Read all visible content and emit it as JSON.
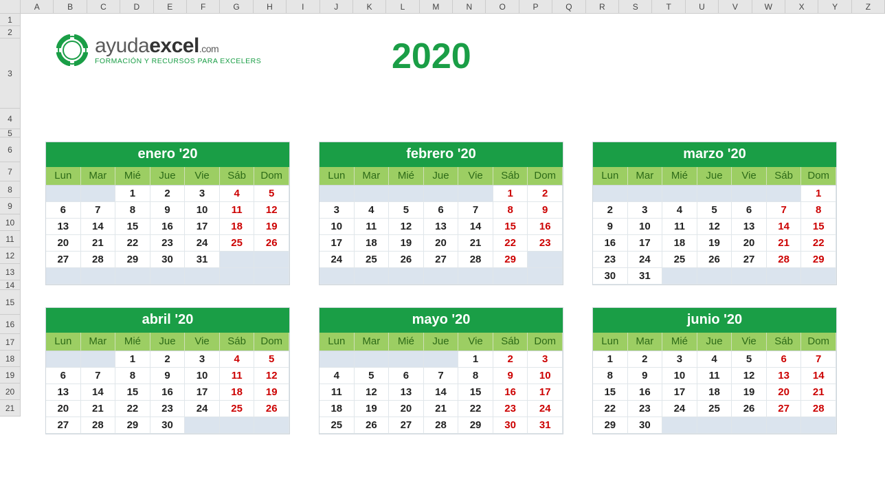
{
  "columns": [
    "A",
    "B",
    "C",
    "D",
    "E",
    "F",
    "G",
    "H",
    "I",
    "J",
    "K",
    "L",
    "M",
    "N",
    "O",
    "P",
    "Q",
    "R",
    "S",
    "T",
    "U",
    "V",
    "W",
    "X",
    "Y",
    "Z"
  ],
  "rows": [
    {
      "n": "1",
      "h": 18
    },
    {
      "n": "2",
      "h": 18
    },
    {
      "n": "3",
      "h": 102
    },
    {
      "n": "4",
      "h": 30
    },
    {
      "n": "5",
      "h": 12
    },
    {
      "n": "6",
      "h": 36
    },
    {
      "n": "7",
      "h": 28
    },
    {
      "n": "8",
      "h": 24
    },
    {
      "n": "9",
      "h": 24
    },
    {
      "n": "10",
      "h": 24
    },
    {
      "n": "11",
      "h": 24
    },
    {
      "n": "12",
      "h": 24
    },
    {
      "n": "13",
      "h": 24
    },
    {
      "n": "14",
      "h": 14
    },
    {
      "n": "15",
      "h": 36
    },
    {
      "n": "16",
      "h": 28
    },
    {
      "n": "17",
      "h": 24
    },
    {
      "n": "18",
      "h": 24
    },
    {
      "n": "19",
      "h": 24
    },
    {
      "n": "20",
      "h": 24
    },
    {
      "n": "21",
      "h": 24
    }
  ],
  "logo": {
    "main_a": "ayuda",
    "main_b": "excel",
    "main_c": ".com",
    "sub": "FORMACIÓN Y RECURSOS PARA EXCELERS"
  },
  "year": "2020",
  "dow": [
    "Lun",
    "Mar",
    "Mié",
    "Jue",
    "Vie",
    "Sáb",
    "Dom"
  ],
  "months": [
    {
      "title": "enero '20",
      "weeks": [
        [
          "",
          "",
          "1",
          "2",
          "3",
          "4",
          "5"
        ],
        [
          "6",
          "7",
          "8",
          "9",
          "10",
          "11",
          "12"
        ],
        [
          "13",
          "14",
          "15",
          "16",
          "17",
          "18",
          "19"
        ],
        [
          "20",
          "21",
          "22",
          "23",
          "24",
          "25",
          "26"
        ],
        [
          "27",
          "28",
          "29",
          "30",
          "31",
          "",
          ""
        ],
        [
          "",
          "",
          "",
          "",
          "",
          "",
          ""
        ]
      ]
    },
    {
      "title": "febrero '20",
      "weeks": [
        [
          "",
          "",
          "",
          "",
          "",
          "1",
          "2"
        ],
        [
          "3",
          "4",
          "5",
          "6",
          "7",
          "8",
          "9"
        ],
        [
          "10",
          "11",
          "12",
          "13",
          "14",
          "15",
          "16"
        ],
        [
          "17",
          "18",
          "19",
          "20",
          "21",
          "22",
          "23"
        ],
        [
          "24",
          "25",
          "26",
          "27",
          "28",
          "29",
          ""
        ],
        [
          "",
          "",
          "",
          "",
          "",
          "",
          ""
        ]
      ]
    },
    {
      "title": "marzo '20",
      "weeks": [
        [
          "",
          "",
          "",
          "",
          "",
          "",
          "1"
        ],
        [
          "2",
          "3",
          "4",
          "5",
          "6",
          "7",
          "8"
        ],
        [
          "9",
          "10",
          "11",
          "12",
          "13",
          "14",
          "15"
        ],
        [
          "16",
          "17",
          "18",
          "19",
          "20",
          "21",
          "22"
        ],
        [
          "23",
          "24",
          "25",
          "26",
          "27",
          "28",
          "29"
        ],
        [
          "30",
          "31",
          "",
          "",
          "",
          "",
          ""
        ]
      ]
    },
    {
      "title": "abril '20",
      "weeks": [
        [
          "",
          "",
          "1",
          "2",
          "3",
          "4",
          "5"
        ],
        [
          "6",
          "7",
          "8",
          "9",
          "10",
          "11",
          "12"
        ],
        [
          "13",
          "14",
          "15",
          "16",
          "17",
          "18",
          "19"
        ],
        [
          "20",
          "21",
          "22",
          "23",
          "24",
          "25",
          "26"
        ],
        [
          "27",
          "28",
          "29",
          "30",
          "",
          "",
          ""
        ]
      ]
    },
    {
      "title": "mayo '20",
      "weeks": [
        [
          "",
          "",
          "",
          "",
          "1",
          "2",
          "3"
        ],
        [
          "4",
          "5",
          "6",
          "7",
          "8",
          "9",
          "10"
        ],
        [
          "11",
          "12",
          "13",
          "14",
          "15",
          "16",
          "17"
        ],
        [
          "18",
          "19",
          "20",
          "21",
          "22",
          "23",
          "24"
        ],
        [
          "25",
          "26",
          "27",
          "28",
          "29",
          "30",
          "31"
        ]
      ]
    },
    {
      "title": "junio '20",
      "weeks": [
        [
          "1",
          "2",
          "3",
          "4",
          "5",
          "6",
          "7"
        ],
        [
          "8",
          "9",
          "10",
          "11",
          "12",
          "13",
          "14"
        ],
        [
          "15",
          "16",
          "17",
          "18",
          "19",
          "20",
          "21"
        ],
        [
          "22",
          "23",
          "24",
          "25",
          "26",
          "27",
          "28"
        ],
        [
          "29",
          "30",
          "",
          "",
          "",
          "",
          ""
        ]
      ]
    }
  ]
}
